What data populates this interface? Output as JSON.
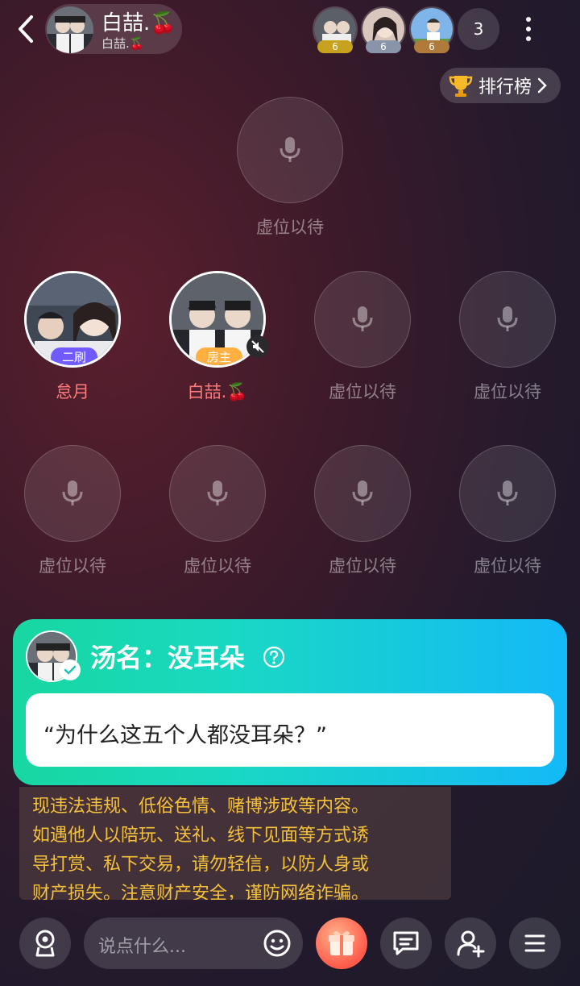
{
  "header": {
    "room_name": "白喆.🍒",
    "room_sub": "白喆.🍒",
    "viewers": [
      {
        "level": "6",
        "badge_color": "#c8a21e"
      },
      {
        "level": "6",
        "badge_color": "#8a94a8"
      },
      {
        "level": "6",
        "badge_color": "#b07a3a"
      }
    ],
    "viewer_count": "3",
    "rank_label": "排行榜"
  },
  "seats": {
    "empty_label": "虚位以待",
    "occupied": [
      {
        "name": "怠月",
        "tag": "二刷",
        "tag_color": "#6f5bff",
        "name_color": "#ff7b7b"
      },
      {
        "name": "白喆.🍒",
        "tag": "房主",
        "tag_color": "#ffb040",
        "name_color": "#ff7b7b"
      }
    ]
  },
  "task_card": {
    "title": "汤名：没耳朵",
    "quote": "“为什么这五个人都没耳朵？”"
  },
  "notice": {
    "lines": [
      "现违法违规、低俗色情、赌博涉政等内容。",
      "如遇他人以陪玩、送礼、线下见面等方式诱",
      "导打赏、私下交易，请勿轻信，以防人身或",
      "财产损失。注意财产安全，谨防网络诈骗。"
    ]
  },
  "bottom_bar": {
    "input_placeholder": "说点什么..."
  },
  "colors": {
    "notice_text": "#f5c13a",
    "card_gradient_start": "#18d7a0",
    "card_gradient_end": "#14b9f7"
  },
  "icons": [
    "back-icon",
    "more-icon",
    "trophy-icon",
    "chevron-right-icon",
    "mic-icon",
    "muted-speaker-icon",
    "help-icon",
    "check-icon",
    "voice-icon",
    "emoji-icon",
    "gift-icon",
    "message-icon",
    "add-user-icon",
    "menu-icon"
  ]
}
